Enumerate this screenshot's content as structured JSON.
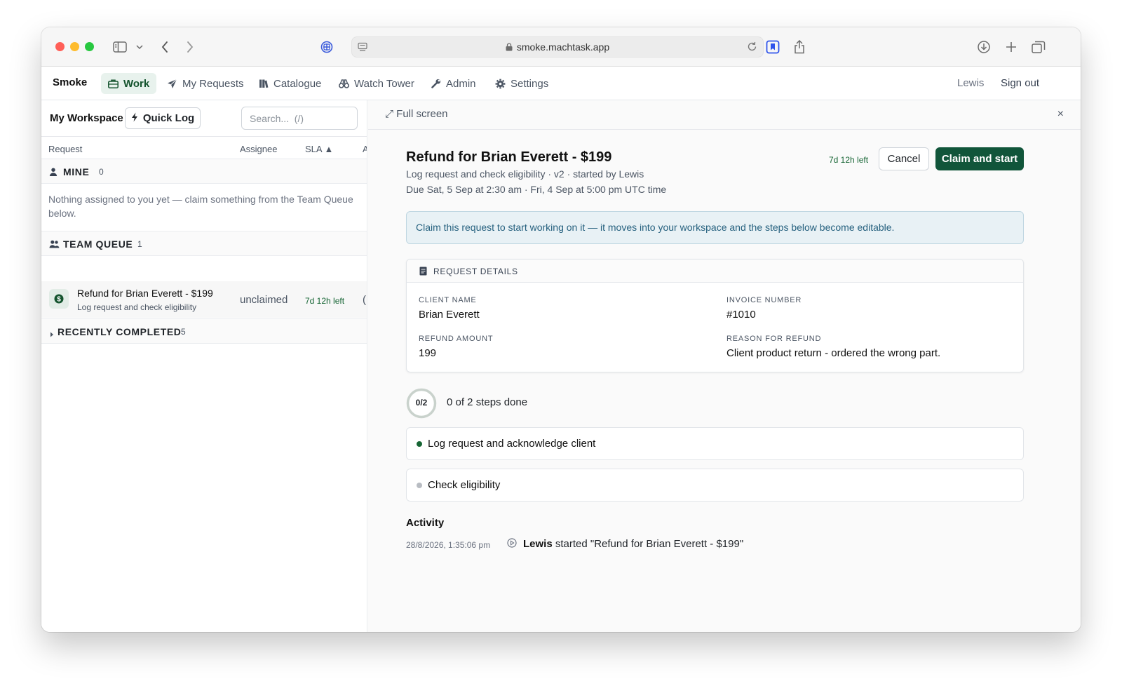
{
  "browser": {
    "url": "smoke.machtask.app",
    "icons": [
      "sidebar-icon",
      "chevron-down-icon",
      "back-icon",
      "forward-icon",
      "extension-icon",
      "page-settings-icon",
      "lock-icon",
      "reload-icon",
      "bookmark-icon",
      "share-icon",
      "download-icon",
      "new-tab-icon",
      "tabs-overview-icon"
    ]
  },
  "nav": {
    "brand": "Smoke",
    "items": [
      {
        "label": "Work",
        "icon": "briefcase-icon",
        "active": true
      },
      {
        "label": "My Requests",
        "icon": "paper-plane-icon"
      },
      {
        "label": "Catalogue",
        "icon": "books-icon"
      },
      {
        "label": "Watch Tower",
        "icon": "binoculars-icon"
      },
      {
        "label": "Admin",
        "icon": "wrench-icon"
      },
      {
        "label": "Settings",
        "icon": "gear-icon"
      }
    ],
    "user": "Lewis",
    "signout": "Sign out"
  },
  "workspace": {
    "title": "My Workspace",
    "quick_log": "Quick Log",
    "search_placeholder": "Search...  (/)",
    "columns": {
      "request": "Request",
      "assignee": "Assignee",
      "sla": "SLA ▲",
      "extra": "A"
    },
    "mine": {
      "label": "MINE",
      "count": "0"
    },
    "empty_message": "Nothing assigned to you yet — claim something from the Team Queue below.",
    "team_queue": {
      "label": "TEAM QUEUE",
      "count": "1"
    },
    "queue_items": [
      {
        "title": "Refund for Brian Everett - $199",
        "subtitle": "Log request and check eligibility",
        "assignee": "unclaimed",
        "sla": "7d 12h left",
        "extra": "(",
        "icon": "dollar-icon"
      }
    ],
    "recently_completed": {
      "label": "RECENTLY COMPLETED",
      "count": "5"
    }
  },
  "detail": {
    "full_screen": "⤢ Full screen",
    "close": "×",
    "title": "Refund for Brian Everett - $199",
    "meta": "Log request and check eligibility · v2 · started by Lewis",
    "due": "Due Sat, 5 Sep at 2:30 am · Fri, 4 Sep at 5:00 pm UTC time",
    "sla_left": "7d 12h left",
    "cancel": "Cancel",
    "claim": "Claim and start",
    "banner": "Claim this request to start working on it — it moves into your workspace and the steps below become editable.",
    "details_header": "REQUEST DETAILS",
    "fields": [
      {
        "label": "CLIENT NAME",
        "value": "Brian Everett"
      },
      {
        "label": "INVOICE NUMBER",
        "value": "#1010"
      },
      {
        "label": "REFUND AMOUNT",
        "value": "199"
      },
      {
        "label": "REASON FOR REFUND",
        "value": "Client product return - ordered the wrong part."
      }
    ],
    "progress": {
      "label": "0/2",
      "text": "0 of 2 steps done",
      "done": 0,
      "total": 2
    },
    "steps": [
      {
        "label": "Log request and acknowledge client",
        "status": "current",
        "color": "#166534"
      },
      {
        "label": "Check eligibility",
        "status": "pending",
        "color": "#b8bcc2"
      }
    ],
    "activity": {
      "title": "Activity",
      "entries": [
        {
          "time": "28/8/2026, 1:35:06 pm",
          "actor": "Lewis",
          "text": " started \"Refund for Brian Everett - $199\""
        }
      ]
    }
  },
  "colors": {
    "accent": "#11553a",
    "active_nav_bg": "#e8f2ed",
    "banner_bg": "#e8f1f5",
    "sla_text": "#166534"
  }
}
